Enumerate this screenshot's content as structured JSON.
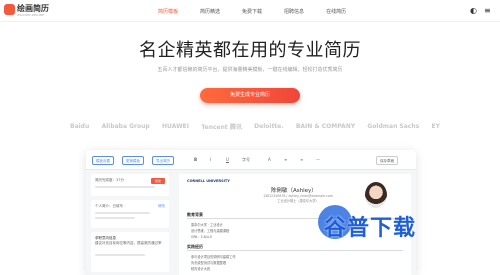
{
  "header": {
    "logo_text": "绘画简历",
    "logo_sub": "ZHAOPIN RESUME",
    "nav": [
      "简历模板",
      "简历精选",
      "免费下载",
      "招聘信息",
      "在线简历"
    ]
  },
  "hero": {
    "title": "名企精英都在用的专业简历",
    "subtitle": "五百人才都信赖的简历平台，提供海量精美模板，一键在线编辑，轻松打造优秀简历",
    "cta_label": "免费生成专业简历"
  },
  "brands": [
    "Baidu",
    "Alibaba Group",
    "HUAWEI",
    "Tencent 腾讯",
    "Deloitte.",
    "BAIN & COMPANY",
    "Goldman Sachs",
    "EY"
  ],
  "editor": {
    "toolbar_buttons": [
      "模板设置",
      "更换模板",
      "导出简历"
    ],
    "tools": [
      "B",
      "I",
      "U",
      "字号",
      "A",
      "≡",
      "∞",
      "—"
    ],
    "save_label": "保存草稿",
    "side": {
      "score_label": "简历完成度：37分",
      "score_button": "优化",
      "tip_text": "个人简介：已填写",
      "tip_action": "修改",
      "section_label": "求职意向信息",
      "section_text": "建议补充目标岗位等内容，提高简历通过率"
    },
    "resume": {
      "university": "CORNELL UNIVERSITY",
      "name": "陈俐敏（Ashley）",
      "info_lines": [
        "15812345678 | ashley_chen@example.com",
        "工业设计硕士（康奈尔大学）"
      ],
      "section_edu": "教育背景",
      "edu_lines": [
        "康奈尔大学 · 工业设计",
        "设计思维、工程与建模课程",
        "GPA：3.8/4.0"
      ],
      "section_exp": "实践经历",
      "exp_lines": [
        "参与设计项目的调研与建模工作",
        "负责原型测试与数据整理",
        "校内设计大赛"
      ]
    }
  },
  "watermark": "谷普下载"
}
